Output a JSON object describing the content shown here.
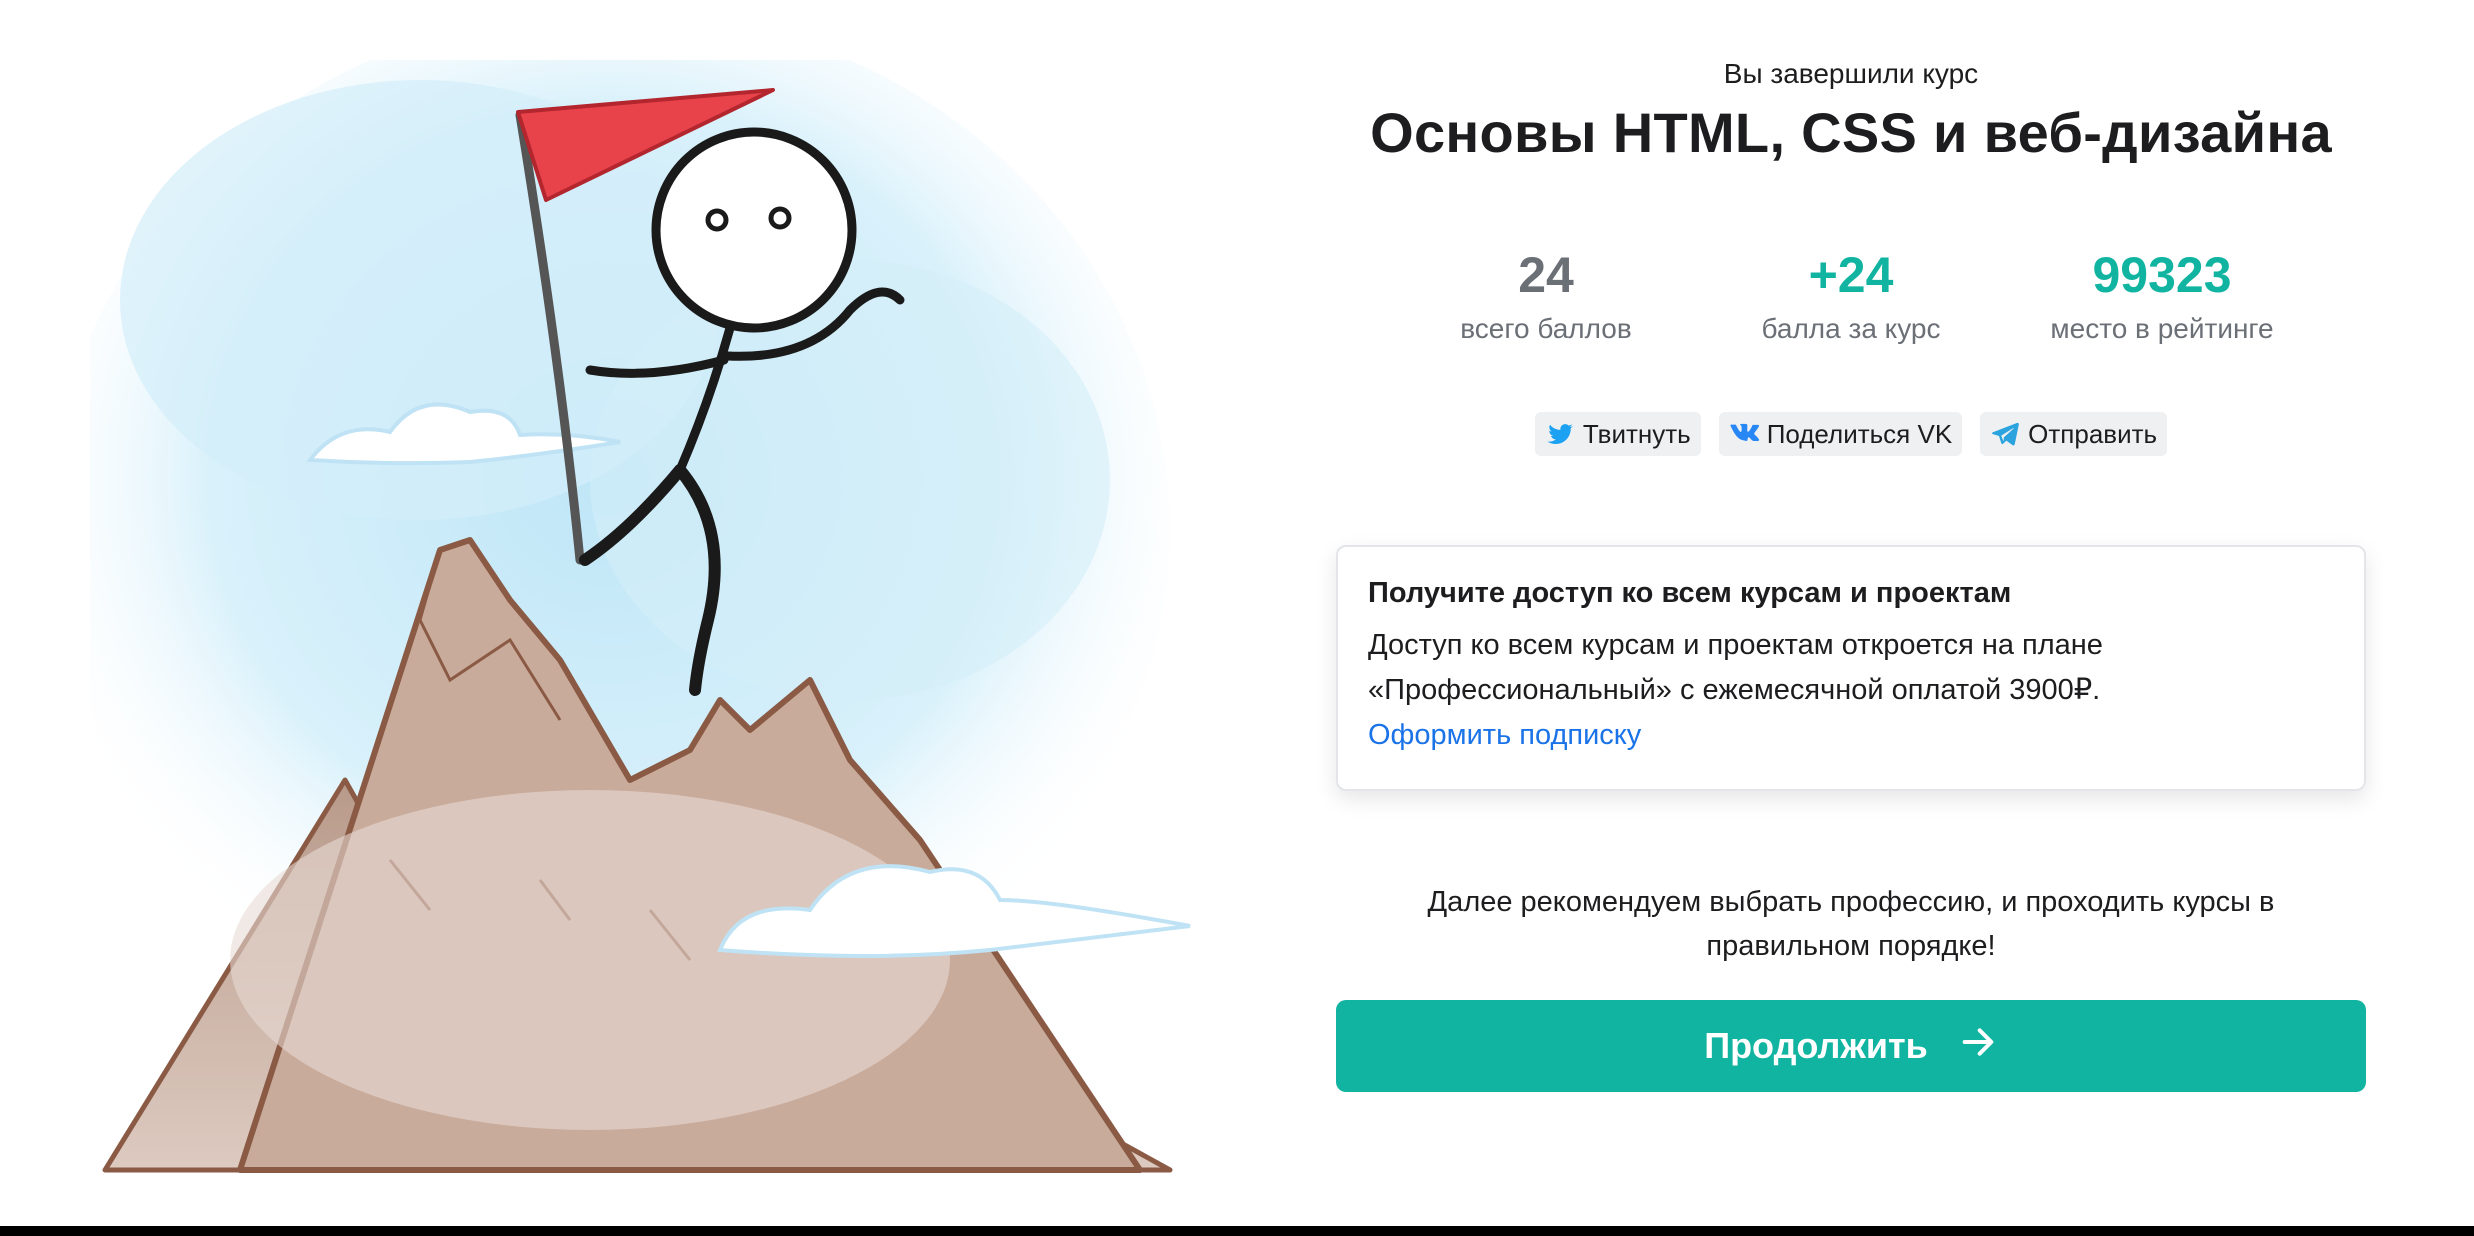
{
  "header": {
    "eyebrow": "Вы завершили курс",
    "course_title": "Основы HTML, CSS и веб-дизайна"
  },
  "stats": [
    {
      "value": "24",
      "label": "всего баллов",
      "color": "#6b6f76"
    },
    {
      "value": "+24",
      "label": "балла за курс",
      "color": "#10b4a0"
    },
    {
      "value": "99323",
      "label": "место в рейтинге",
      "color": "#10b4a0"
    }
  ],
  "share": {
    "twitter": {
      "label": "Твитнуть",
      "icon": "twitter-icon",
      "color": "#1da1f2"
    },
    "vk": {
      "label": "Поделиться VK",
      "icon": "vk-icon",
      "color": "#2787f5"
    },
    "telegram": {
      "label": "Отправить",
      "icon": "telegram-icon",
      "color": "#2aa3df"
    }
  },
  "promo": {
    "title": "Получите доступ ко всем курсам и проектам",
    "text_line1": "Доступ ко всем курсам и проектам откроется на плане",
    "text_line2": "«Профессиональный» с ежемесячной оплатой 3900₽.",
    "link": "Оформить подписку"
  },
  "recommend": {
    "line1": "Далее рекомендуем выбрать профессию, и проходить курсы в",
    "line2": "правильном порядке!"
  },
  "continue_button": {
    "label": "Продолжить",
    "icon": "arrow-right-icon"
  },
  "colors": {
    "accent": "#10b4a0",
    "link": "#1b73e8",
    "flag": "#e8434b"
  }
}
